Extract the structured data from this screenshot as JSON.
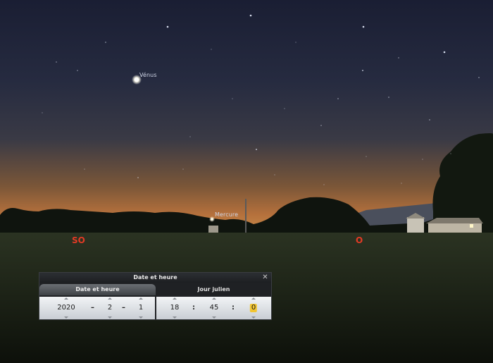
{
  "sky": {
    "planets": {
      "venus": {
        "label": "Vénus"
      },
      "mercury": {
        "label": "Mercure"
      }
    },
    "cardinals": {
      "southwest": "SO",
      "west": "O"
    },
    "colors": {
      "sky_top": "#1c2136",
      "sky_mid": "#2e3347",
      "horizon_glow": "#b4703c",
      "ground": "#20261a",
      "cardinal": "#e33a25"
    }
  },
  "dialog": {
    "title": "Date et heure",
    "close_icon": "close-icon",
    "tabs": [
      {
        "label": "Date et heure",
        "active": true
      },
      {
        "label": "Jour julien",
        "active": false
      }
    ],
    "date": {
      "year": "2020",
      "month": "2",
      "day": "1",
      "separator": "–"
    },
    "time": {
      "hour": "18",
      "minute": "45",
      "second": "0",
      "separator": ":"
    }
  }
}
